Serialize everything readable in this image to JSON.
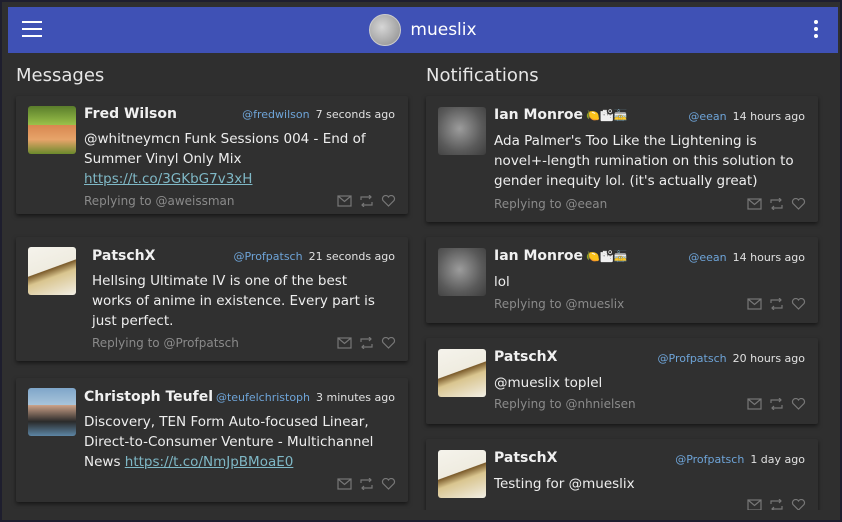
{
  "topbar": {
    "username": "mueslix"
  },
  "messages": {
    "title": "Messages",
    "items": [
      {
        "name": "Fred Wilson",
        "handle": "@fredwilson",
        "time": "7 seconds ago",
        "text": "@whitneymcn Funk Sessions 004 - End of Summer Vinyl Only Mix ",
        "link": "https://t.co/3GKbG7v3xH",
        "reply": "Replying to @aweissman"
      },
      {
        "name": "PatschX",
        "handle": "@Profpatsch",
        "time": "21 seconds ago",
        "text": "Hellsing Ultimate IV is one of the best works of anime in existence. Every part is just perfect.",
        "link": "",
        "reply": "Replying to @Profpatsch"
      },
      {
        "name": "Christoph Teufel",
        "handle": "@teufelchristoph",
        "time": "3 minutes ago",
        "text": "Discovery, TEN Form Auto-focused Linear, Direct-to-Consumer Venture - Multichannel News ",
        "link": "https://t.co/NmJpBMoaE0",
        "reply": ""
      }
    ]
  },
  "notifications": {
    "title": "Notifications",
    "items": [
      {
        "name": "Ian Monroe",
        "emoji": "🍋🏙🚋",
        "handle": "@eean",
        "time": "14 hours ago",
        "text": "Ada Palmer's Too Like the Lightening is novel+-length rumination on this solution to gender inequity lol. (it's actually great)",
        "reply": "Replying to @eean"
      },
      {
        "name": "Ian Monroe",
        "emoji": "🍋🏙🚋",
        "handle": "@eean",
        "time": "14 hours ago",
        "text": "lol",
        "reply": "Replying to @mueslix"
      },
      {
        "name": "PatschX",
        "emoji": "",
        "handle": "@Profpatsch",
        "time": "20 hours ago",
        "text": "@mueslix toplel",
        "reply": "Replying to @nhnielsen"
      },
      {
        "name": "PatschX",
        "emoji": "",
        "handle": "@Profpatsch",
        "time": "1 day ago",
        "text": "Testing for @mueslix",
        "reply": ""
      }
    ]
  },
  "icons": {
    "menu": "menu-icon",
    "more": "more-vert-icon",
    "reply": "mail-icon",
    "retweet": "retweet-icon",
    "like": "heart-icon"
  }
}
